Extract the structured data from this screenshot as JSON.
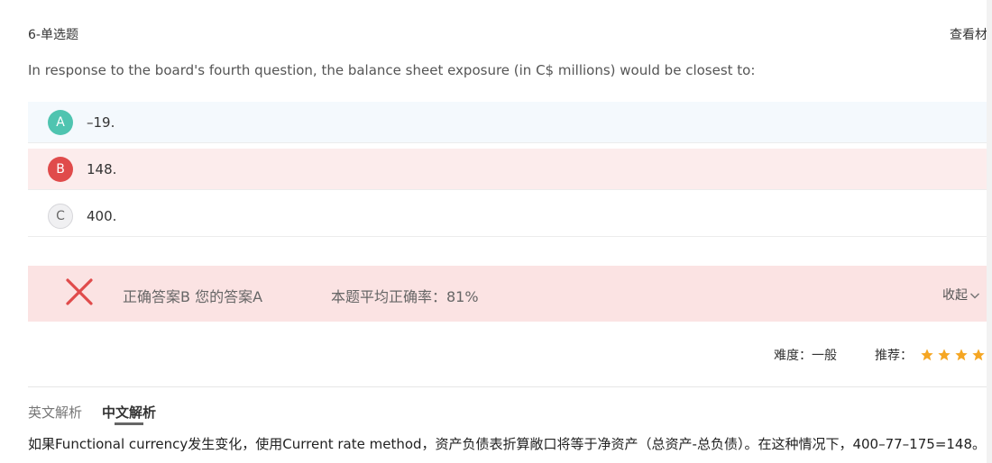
{
  "question": {
    "index": "6-单选题",
    "view_material": "查看材",
    "text": "In response to the board's fourth question, the balance sheet exposure (in C$ millions) would be closest to:"
  },
  "options": [
    {
      "letter": "A",
      "text": "–19."
    },
    {
      "letter": "B",
      "text": "148."
    },
    {
      "letter": "C",
      "text": "400."
    }
  ],
  "result": {
    "answer_info": "正确答案B 您的答案A",
    "avg_rate": "本题平均正确率：81%",
    "collapse_label": "收起"
  },
  "meta": {
    "difficulty": "难度：一般",
    "recommend": "推荐：",
    "stars_shown": 4
  },
  "tabs": {
    "english": "英文解析",
    "chinese": "中文解析"
  },
  "explanation": "如果Functional currency发生变化，使用Current rate method，资产负债表折算敞口将等于净资产（总资产-总负债）。在这种情况下，400–77–175=148。",
  "colors": {
    "correct_option": "#4fc4b0",
    "wrong_option": "#e04b4b",
    "wrong_bg": "#fbe3e3",
    "star": "#f5a623"
  }
}
